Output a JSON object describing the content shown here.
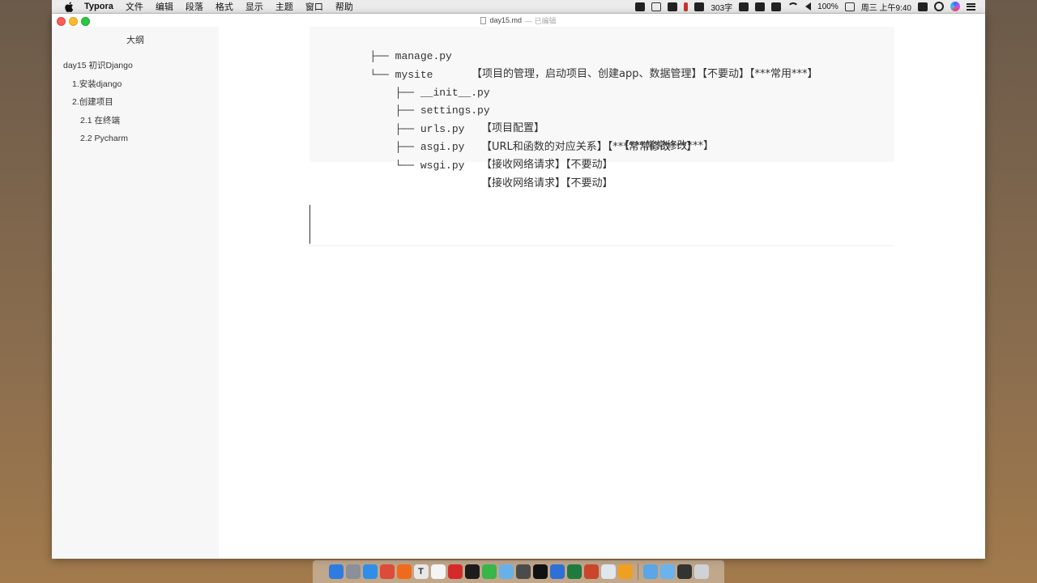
{
  "menubar": {
    "app_name": "Typora",
    "menus": [
      "文件",
      "编辑",
      "段落",
      "格式",
      "显示",
      "主题",
      "窗口",
      "帮助"
    ],
    "word_count": "303字",
    "battery": "100%",
    "clock": "周三 上午9:40"
  },
  "window": {
    "filename": "day15.md",
    "status": "— 已编辑"
  },
  "sidebar": {
    "title": "大纲",
    "items": [
      {
        "label": "day15 初识Django"
      },
      {
        "label": "1.安装django"
      },
      {
        "label": "2.创建项目"
      },
      {
        "label": "2.1 在终端"
      },
      {
        "label": "2.2 Pycharm"
      }
    ]
  },
  "code_block": {
    "lines": [
      {
        "tree": "├── ",
        "name": "manage.py",
        "comment": "【项目的管理，启动项目、创建app、数据管理】【不要动】【***常用***】"
      },
      {
        "tree": "└── ",
        "name": "mysite",
        "comment": ""
      },
      {
        "tree": "    ├── ",
        "name": "__init__.py",
        "comment": ""
      },
      {
        "tree": "    ├── ",
        "name": "settings.py",
        "comment": "【项目配置】",
        "comment2": "【***常常修改***】"
      },
      {
        "tree": "    ├── ",
        "name": "urls.py",
        "comment": "【URL和函数的对应关系】【***常常修改***】"
      },
      {
        "tree": "    ├── ",
        "name": "asgi.py",
        "comment": "【接收网络请求】【不要动】"
      },
      {
        "tree": "    └── ",
        "name": "wsgi.py",
        "comment": "【接收网络请求】【不要动】"
      }
    ]
  },
  "dock": {
    "icons": [
      {
        "name": "finder-icon",
        "color": "#2f7ce0",
        "glyph": ""
      },
      {
        "name": "launchpad-icon",
        "color": "#8a8f99",
        "glyph": ""
      },
      {
        "name": "safari-icon",
        "color": "#2f8fe8",
        "glyph": ""
      },
      {
        "name": "chrome-icon",
        "color": "#dd4b39",
        "glyph": ""
      },
      {
        "name": "firefox-icon",
        "color": "#f06a1b",
        "glyph": ""
      },
      {
        "name": "typora-icon",
        "color": "#e8e8e8",
        "glyph": "T"
      },
      {
        "name": "calendar-icon",
        "color": "#f4f4f4",
        "glyph": ""
      },
      {
        "name": "netease-music-icon",
        "color": "#d42a2a",
        "glyph": ""
      },
      {
        "name": "pycharm-icon",
        "color": "#1c1c1c",
        "glyph": ""
      },
      {
        "name": "wechat-icon",
        "color": "#39b54a",
        "glyph": ""
      },
      {
        "name": "preview-icon",
        "color": "#6ab0e8",
        "glyph": ""
      },
      {
        "name": "sublime-icon",
        "color": "#4b4b4b",
        "glyph": ""
      },
      {
        "name": "terminal-icon",
        "color": "#111111",
        "glyph": ""
      },
      {
        "name": "xmind-icon",
        "color": "#2f6fd6",
        "glyph": ""
      },
      {
        "name": "excel-icon",
        "color": "#1f7a3f",
        "glyph": ""
      },
      {
        "name": "powerpoint-icon",
        "color": "#c9452b",
        "glyph": ""
      },
      {
        "name": "photos-icon",
        "color": "#dfe6ee",
        "glyph": ""
      },
      {
        "name": "notes-icon",
        "color": "#f0a020",
        "glyph": ""
      },
      {
        "name": "folder-icon",
        "color": "#5aa6e6",
        "glyph": ""
      },
      {
        "name": "folder2-icon",
        "color": "#6ab3ec",
        "glyph": ""
      },
      {
        "name": "app-dark-icon",
        "color": "#333333",
        "glyph": ""
      },
      {
        "name": "trash-icon",
        "color": "#cfd3d8",
        "glyph": ""
      }
    ]
  }
}
